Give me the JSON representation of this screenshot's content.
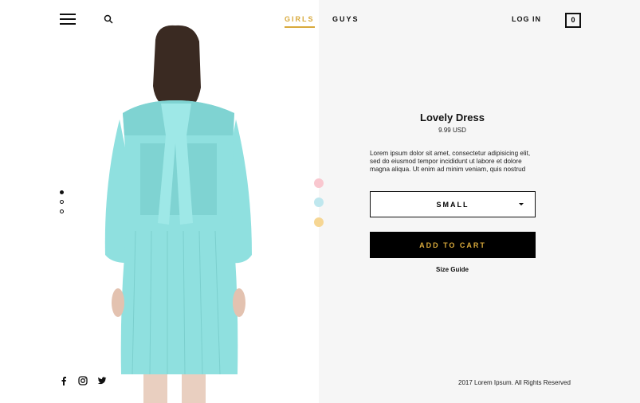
{
  "nav": {
    "menu_icon": "hamburger-menu-icon",
    "search_icon": "search-icon",
    "girls_label": "GIRLS",
    "guys_label": "GUYS",
    "login_label": "LOG IN",
    "cart_count": "0",
    "accent_color": "#d8a93b"
  },
  "product": {
    "title": "Lovely Dress",
    "price": "9.99 USD",
    "description": "Lorem ipsum dolor sit amet, consectetur adipisicing elit, sed do eiusmod tempor incididunt ut labore et dolore magna aliqua. Ut enim ad minim veniam, quis nostrud",
    "size_selected": "SMALL",
    "add_to_cart_label": "ADD TO CART",
    "size_guide_label": "Size Guide",
    "color_swatches": [
      "#f9c7cf",
      "#bfe7ee",
      "#f6d693"
    ],
    "dress_color": "#8fe0df"
  },
  "slider": {
    "active_index": 0,
    "count": 3
  },
  "social": [
    "facebook-icon",
    "instagram-icon",
    "twitter-icon"
  ],
  "footer": {
    "copyright": "2017 Lorem Ipsum. All Rights Reserved"
  }
}
